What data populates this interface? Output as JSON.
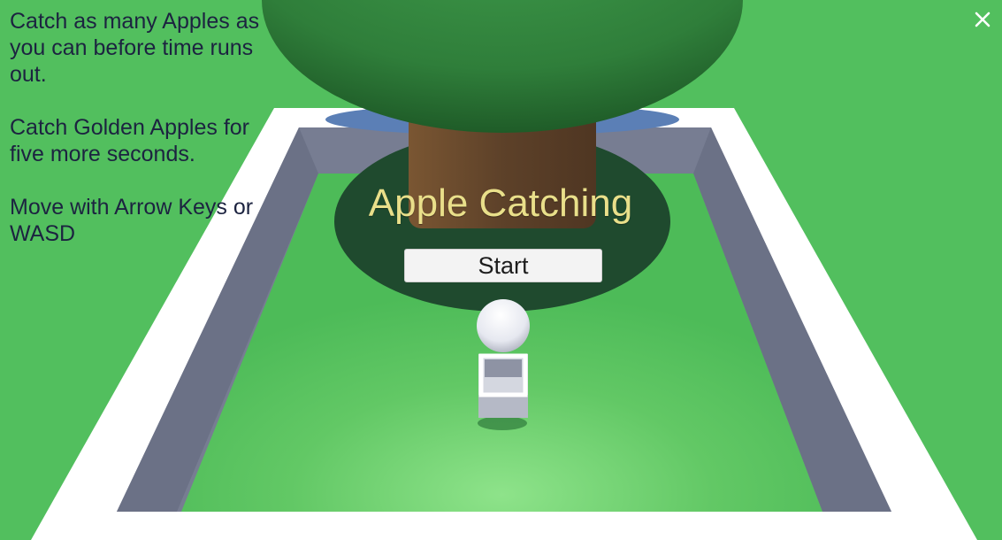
{
  "instructions": {
    "line1": "Catch as many Apples as you can before time runs out.",
    "line2": "Catch Golden Apples for five more seconds.",
    "line3": "Move with Arrow Keys or WASD"
  },
  "menu": {
    "title": "Apple Catching",
    "start_label": "Start"
  },
  "window": {
    "close_icon": "close-icon"
  },
  "colors": {
    "ground": "#4fbf5c",
    "tree_canopy": "#3d9a4a",
    "tree_trunk": "#6a4a2e",
    "fence_top": "#ffffff",
    "fence_inner": "#7b8196",
    "title_text": "#e9df8a",
    "instruction_text": "#1c2340"
  }
}
